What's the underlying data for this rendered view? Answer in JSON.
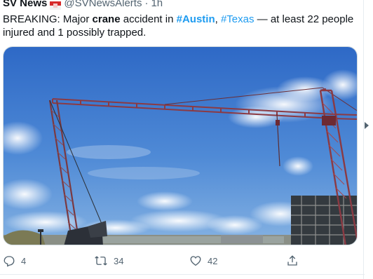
{
  "tweet": {
    "author_name": "SV News",
    "flag_icon": "flag-icon",
    "handle": "@SVNewsAlerts",
    "dot": "·",
    "time": "1h",
    "text_parts": {
      "p1": "BREAKING: Major ",
      "p2": "crane",
      "p3": " accident in ",
      "p4": "#Austin",
      "p5": ", ",
      "p6": "#Texas",
      "p7": " — at least 22 people injured and 1 possibly trapped."
    },
    "media_alt": "Construction cranes against a blue sky"
  },
  "actions": {
    "reply": {
      "icon": "reply-icon",
      "count": "4"
    },
    "retweet": {
      "icon": "retweet-icon",
      "count": "34"
    },
    "like": {
      "icon": "like-icon",
      "count": "42"
    },
    "share": {
      "icon": "share-icon"
    }
  },
  "colors": {
    "link": "#1d9bf0",
    "muted": "#536471",
    "text": "#0f1419"
  }
}
